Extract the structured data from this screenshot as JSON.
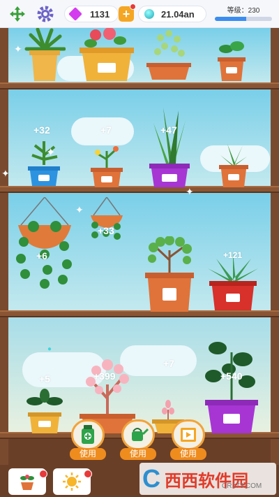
{
  "hud": {
    "gems": "1131",
    "coins": "21.04an",
    "level_label": "等级：230",
    "level_progress": 0.55
  },
  "floats": [
    "+32",
    "+7",
    "+47",
    "+33",
    "+6",
    "+121",
    "+5",
    "+399",
    "+7",
    "+540"
  ],
  "tools": [
    {
      "icon": "fertilizer-icon",
      "label": "使用"
    },
    {
      "icon": "watering-can-icon",
      "label": "使用"
    },
    {
      "icon": "video-icon",
      "label": "使用"
    }
  ],
  "bottom_tabs": [
    {
      "icon": "potted-plant-icon"
    },
    {
      "icon": "sun-icon"
    }
  ],
  "watermark": {
    "main": "西西软件园",
    "sub": "CR173.COM"
  },
  "colors": {
    "accent": "#f5a623",
    "gem": "#d43cf0",
    "badge": "#e83a3a",
    "shelf": "#8a5534"
  }
}
